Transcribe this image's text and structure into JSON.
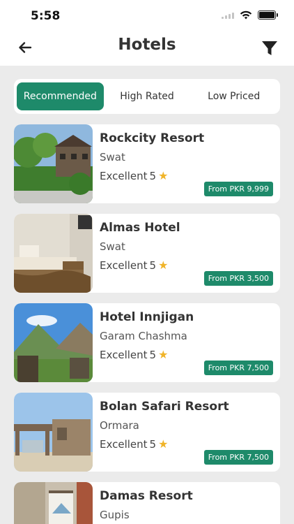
{
  "status": {
    "time": "5:58"
  },
  "nav": {
    "title": "Hotels"
  },
  "tabs": [
    {
      "label": "Recommended",
      "active": true
    },
    {
      "label": "High Rated",
      "active": false
    },
    {
      "label": "Low Priced",
      "active": false
    }
  ],
  "hotels": [
    {
      "name": "Rockcity Resort",
      "location": "Swat",
      "rating_text": "Excellent",
      "rating": "5",
      "price": "From PKR 9,999"
    },
    {
      "name": "Almas Hotel",
      "location": "Swat",
      "rating_text": "Excellent",
      "rating": "5",
      "price": "From PKR 3,500"
    },
    {
      "name": "Hotel Innjigan",
      "location": "Garam Chashma",
      "rating_text": "Excellent",
      "rating": "5",
      "price": "From PKR 7,500"
    },
    {
      "name": "Bolan Safari Resort",
      "location": "Ormara",
      "rating_text": "Excellent",
      "rating": "5",
      "price": "From PKR 7,500"
    },
    {
      "name": "Damas Resort",
      "location": "Gupis"
    }
  ],
  "colors": {
    "accent": "#1e8a6a",
    "star": "#f0b429",
    "background": "#ebebeb"
  }
}
